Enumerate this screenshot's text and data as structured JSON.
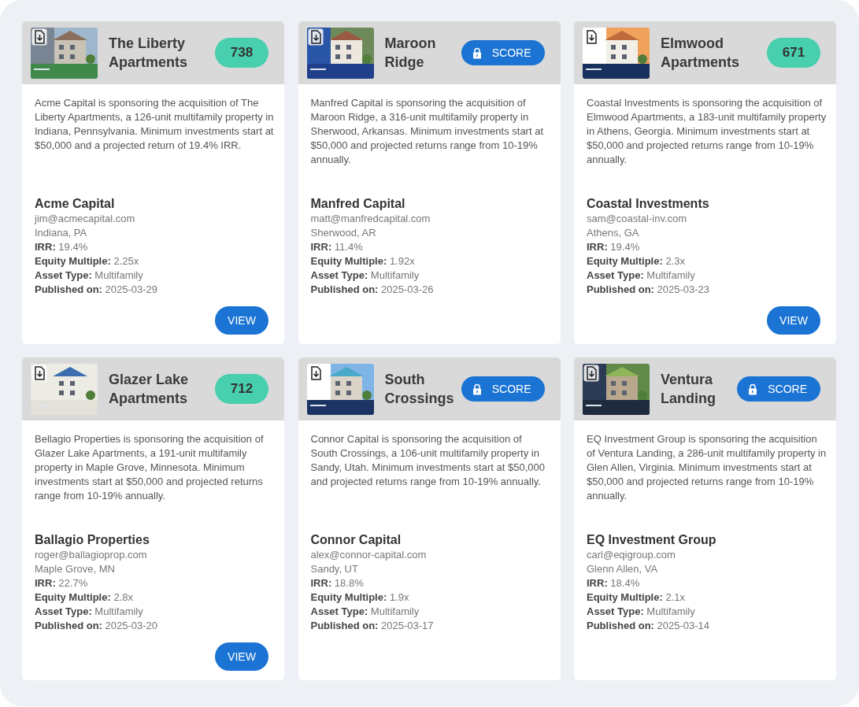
{
  "deals": [
    {
      "title": "The Liberty Apartments",
      "score": {
        "kind": "value",
        "text": "738"
      },
      "description": "Acme Capital is sponsoring the acquisition of The Liberty Apartments, a 126-unit multifamily property in Indiana, Pennsylvania. Minimum investments start at $50,000 and a projected return of 19.4% IRR.",
      "sponsor": "Acme Capital",
      "email": "jim@acmecapital.com",
      "location": "Indiana, PA",
      "details": [
        {
          "label": "IRR:",
          "value": "19.4%"
        },
        {
          "label": "Equity Multiple:",
          "value": "2.25x"
        },
        {
          "label": "Asset Type:",
          "value": "Multifamily"
        },
        {
          "label": "Published on:",
          "value": "2025-03-29"
        }
      ],
      "view_button": "VIEW"
    },
    {
      "title": "Maroon Ridge",
      "score": {
        "kind": "locked",
        "text": "SCORE"
      },
      "description": "Manfred Capital is sponsoring the acquisition of Maroon Ridge, a 316-unit multifamily property in Sherwood, Arkansas. Minimum investments start at $50,000 and projected returns range from 10-19% annually.",
      "sponsor": "Manfred Capital",
      "email": "matt@manfredcapital.com",
      "location": "Sherwood, AR",
      "details": [
        {
          "label": "IRR:",
          "value": "11.4%"
        },
        {
          "label": "Equity Multiple:",
          "value": "1.92x"
        },
        {
          "label": "Asset Type:",
          "value": "Multifamily"
        },
        {
          "label": "Published on:",
          "value": "2025-03-26"
        }
      ]
    },
    {
      "title": "Elmwood Apartments",
      "score": {
        "kind": "value",
        "text": "671"
      },
      "description": "Coastal Investments is sponsoring the acquisition of Elmwood Apartments, a 183-unit multifamily property in Athens, Georgia. Minimum investments start at $50,000 and projected returns range from 10-19% annually.",
      "sponsor": "Coastal Investments",
      "email": "sam@coastal-inv.com",
      "location": "Athens, GA",
      "details": [
        {
          "label": "IRR:",
          "value": "19.4%"
        },
        {
          "label": "Equity Multiple:",
          "value": "2.3x"
        },
        {
          "label": "Asset Type:",
          "value": "Multifamily"
        },
        {
          "label": "Published on:",
          "value": "2025-03-23"
        }
      ],
      "view_button": "VIEW"
    },
    {
      "title": "Glazer Lake Apartments",
      "score": {
        "kind": "value",
        "text": "712"
      },
      "description": "Bellagio Properties is sponsoring the acquisition of Glazer Lake Apartments, a 191-unit multifamily property in Maple Grove, Minnesota. Minimum investments start at $50,000 and projected returns range from 10-19% annually.",
      "sponsor": "Ballagio Properties",
      "email": "roger@ballagioprop.com",
      "location": "Maple Grove, MN",
      "details": [
        {
          "label": "IRR:",
          "value": "22.7%"
        },
        {
          "label": "Equity Multiple:",
          "value": "2.8x"
        },
        {
          "label": "Asset Type:",
          "value": "Multifamily"
        },
        {
          "label": "Published on:",
          "value": "2025-03-20"
        }
      ],
      "view_button": "VIEW"
    },
    {
      "title": "South Crossings",
      "score": {
        "kind": "locked",
        "text": "SCORE"
      },
      "description": "Connor Capital is sponsoring the acquisition of South Crossings, a 106-unit multifamily property in Sandy, Utah. Minimum investments start at $50,000 and projected returns range from 10-19% annually.",
      "sponsor": "Connor Capital",
      "email": "alex@connor-capital.com",
      "location": "Sandy, UT",
      "details": [
        {
          "label": "IRR:",
          "value": "18.8%"
        },
        {
          "label": "Equity Multiple:",
          "value": "1.9x"
        },
        {
          "label": "Asset Type:",
          "value": "Multifamily"
        },
        {
          "label": "Published on:",
          "value": "2025-03-17"
        }
      ]
    },
    {
      "title": "Ventura Landing",
      "score": {
        "kind": "locked",
        "text": "SCORE"
      },
      "description": "EQ Investment Group is sponsoring the acquisition of Ventura Landing, a 286-unit multifamily property in Glen Allen, Virginia. Minimum investments start at $50,000 and projected returns range from 10-19% annually.",
      "sponsor": "EQ Investment Group",
      "email": "carl@eqigroup.com",
      "location": "Glenn Allen, VA",
      "details": [
        {
          "label": "IRR:",
          "value": "18.4%"
        },
        {
          "label": "Equity Multiple:",
          "value": "2.1x"
        },
        {
          "label": "Asset Type:",
          "value": "Multifamily"
        },
        {
          "label": "Published on:",
          "value": "2025-03-14"
        }
      ]
    }
  ]
}
